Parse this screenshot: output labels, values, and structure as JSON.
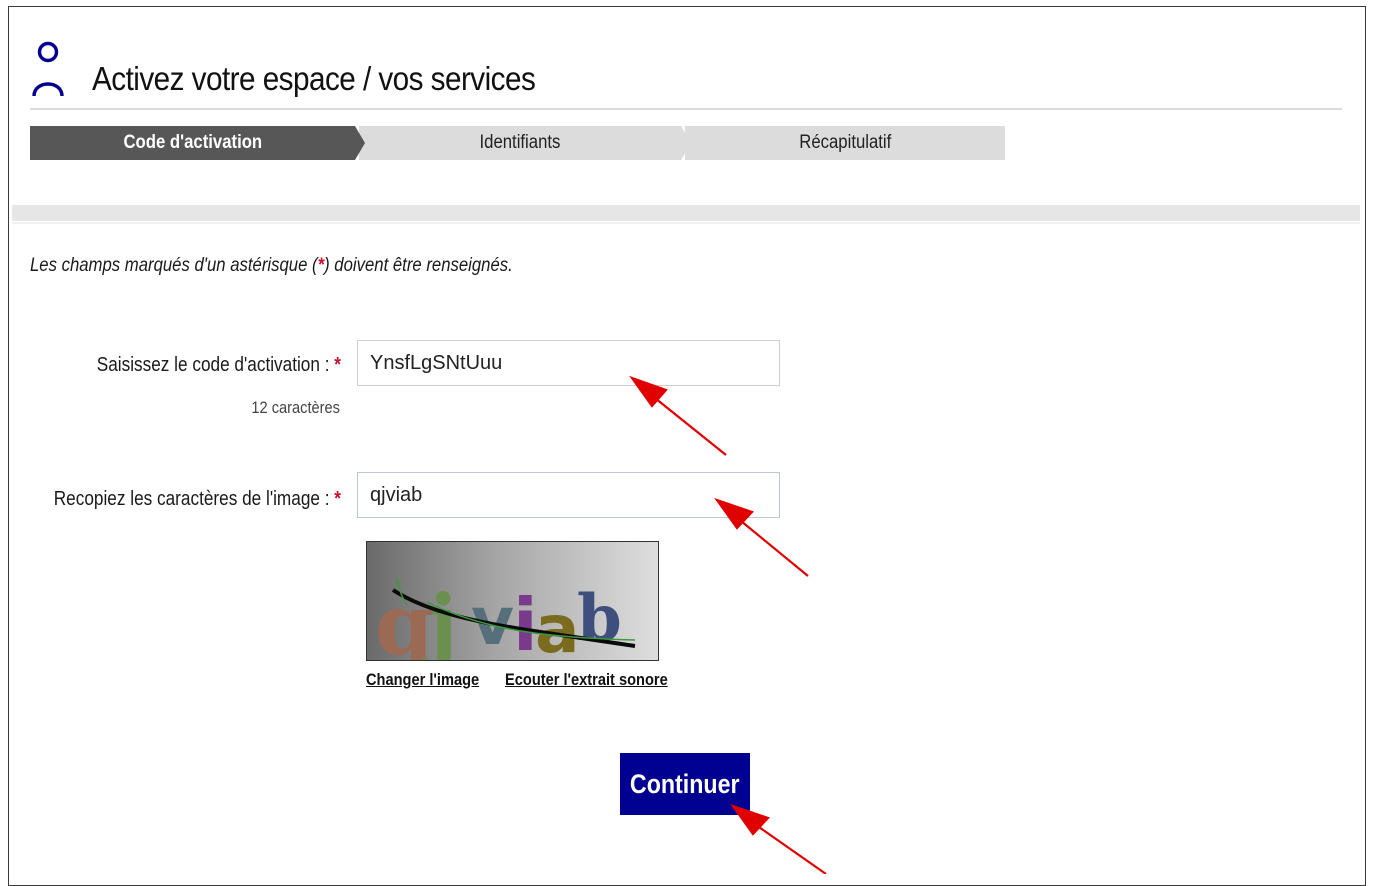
{
  "header": {
    "title": "Activez votre espace / vos services",
    "icon": "user-icon"
  },
  "stepper": {
    "steps": [
      {
        "label": "Code d'activation",
        "active": true
      },
      {
        "label": "Identifiants",
        "active": false
      },
      {
        "label": "Récapitulatif",
        "active": false
      }
    ]
  },
  "form": {
    "required_note_before": "Les champs marqués d'un astérisque (",
    "required_note_star": "*",
    "required_note_after": ") doivent être renseignés.",
    "activation_code": {
      "label": "Saisissez le code d'activation :",
      "required_mark": "*",
      "value": "YnsfLgSNtUuu",
      "hint": "12 caractères"
    },
    "captcha": {
      "label": "Recopiez les caractères de l'image :",
      "required_mark": "*",
      "value": "qjviab",
      "image_text": "qjviab",
      "change_image_link": "Changer l'image",
      "audio_link": "Ecouter l'extrait sonore"
    },
    "submit_label": "Continuer"
  },
  "colors": {
    "primary_button": "#000091",
    "active_step": "#575757",
    "inactive_step": "#dcdcdc",
    "required": "#c8102e",
    "annotation_arrow": "#e00000"
  }
}
